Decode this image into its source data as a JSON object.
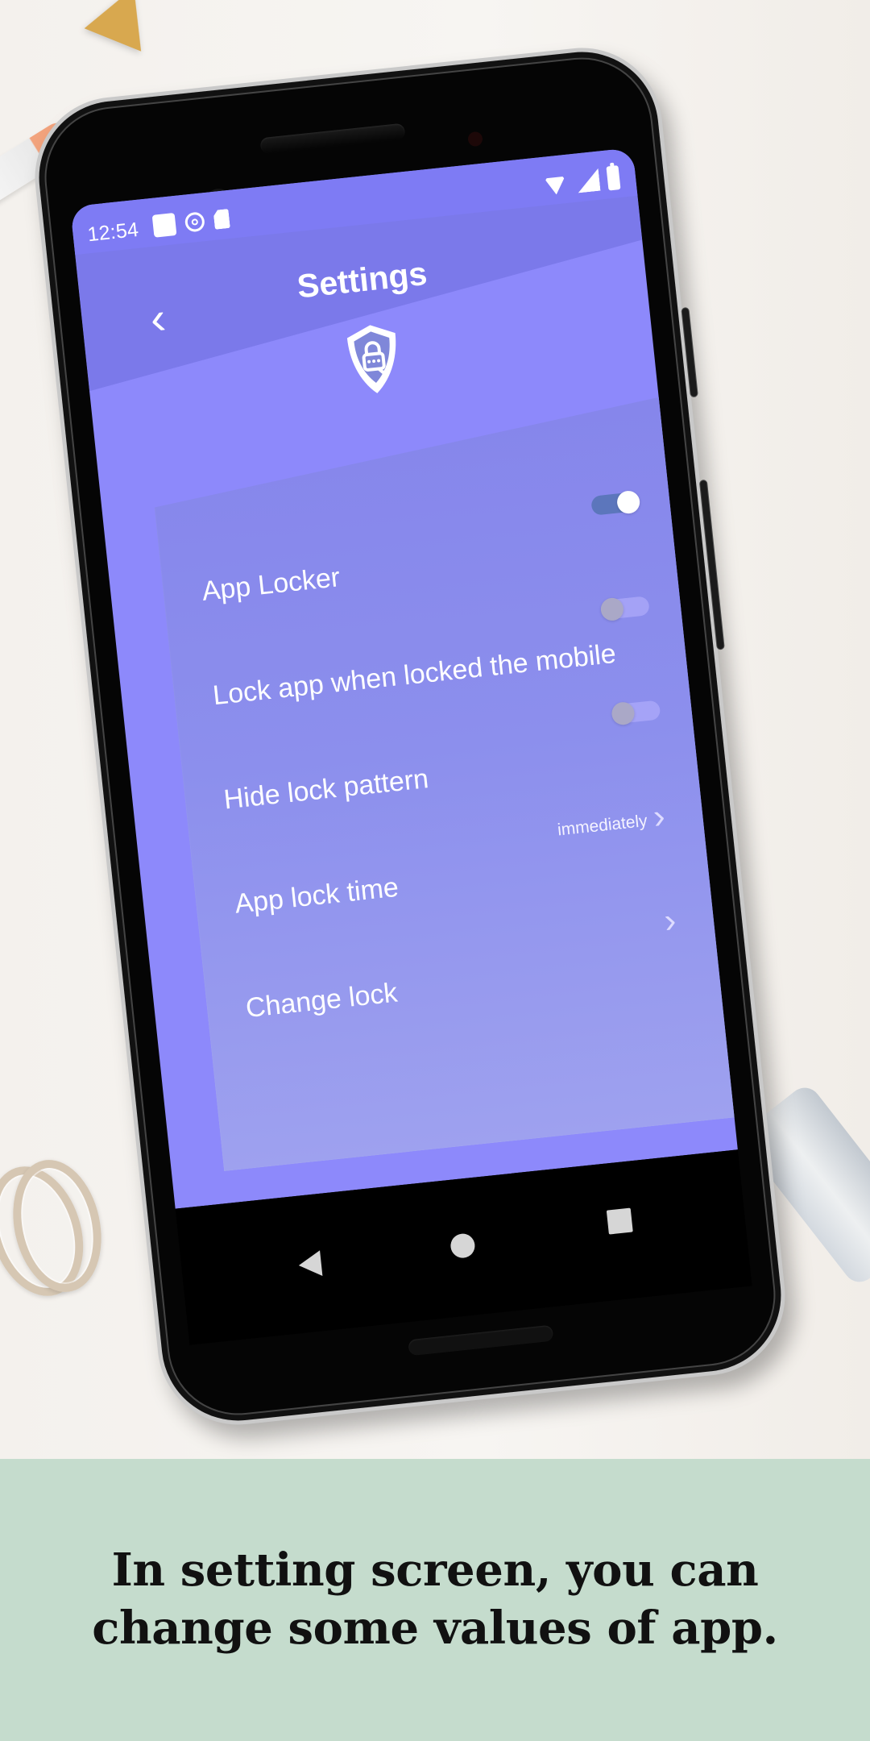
{
  "status_bar": {
    "time": "12:54"
  },
  "settings_screen": {
    "title": "Settings",
    "items": [
      {
        "label": "App Locker",
        "control": "toggle",
        "state": "on"
      },
      {
        "label": "Lock app when locked the mobile",
        "control": "toggle",
        "state": "off"
      },
      {
        "label": "Hide lock pattern",
        "control": "toggle",
        "state": "off"
      },
      {
        "label": "App lock time",
        "value": "immediately",
        "control": "chevron"
      },
      {
        "label": "Change lock",
        "control": "chevron"
      }
    ]
  },
  "caption": {
    "text": "In setting screen, you can\nchange some values of app."
  },
  "icons": {
    "back": "back-arrow-icon",
    "shield": "shield-lock-icon",
    "chevron": "chevron-right-icon",
    "wifi": "wifi-icon",
    "signal": "signal-icon",
    "battery": "battery-icon"
  },
  "colors": {
    "screen_primary": "#8d89fb",
    "screen_header": "#7b79ea",
    "card": "#8c8fed",
    "caption_background": "#c5dccd",
    "toggle_on": "#5c76bc"
  }
}
